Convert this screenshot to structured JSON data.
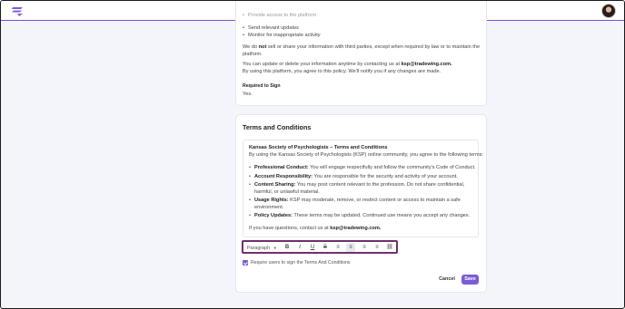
{
  "app": {
    "accent_color": "#7c5cd6",
    "toolbar_highlight_color": "#6f2f6e"
  },
  "privacy": {
    "bullet_partial": "Provide access to the platform",
    "bullets": [
      "Send relevant updates",
      "Monitor for inappropriate activity"
    ],
    "share_line1_pre": "We do ",
    "share_line1_bold": "not",
    "share_line1_post": " sell or share your information with third parties, except when required by law or to maintain the",
    "share_line2": "platform.",
    "update_line_pre": "You can update or delete your information anytime by contacting us at ",
    "update_line_email": "ksp@tradewing.com.",
    "agree_line": "By using this platform, you agree to this policy. We'll notify you if any changes are made.",
    "required_label": "Required to Sign",
    "required_value": "Yes."
  },
  "terms": {
    "section_title": "Terms and Conditions",
    "doc_title": "Kansas Society of Psychologists – Terms and Conditions",
    "intro": "By using the Kansas Society of Psychologists (KSP) online community, you agree to the following terms:",
    "items": [
      {
        "label": "Professional Conduct:",
        "text": " You will engage respectfully and follow the community's Code of Conduct."
      },
      {
        "label": "Account Responsibility:",
        "text": " You are responsible for the security and activity of your account."
      },
      {
        "label": "Content Sharing:",
        "text": " You may post content relevant to the profession. Do not share confidential,",
        "text2": "harmful, or unlawful material."
      },
      {
        "label": "Usage Rights:",
        "text": " KSP may moderate, remove, or restrict content or access to maintain a safe",
        "text2": "environment."
      },
      {
        "label": "Policy Updates:",
        "text": " These terms may be updated. Continued use means you accept any changes."
      }
    ],
    "contact_pre": "If you have questions, contact us at ",
    "contact_email": "ksp@tradewing.com."
  },
  "toolbar": {
    "paragraph_label": "Paragraph",
    "bold_glyph": "B",
    "italic_glyph": "I",
    "underline_glyph": "U",
    "strike_glyph": "S",
    "bullet_glyph": "≡",
    "align_left_glyph": "≡",
    "align_center_glyph": "≡",
    "align_right_glyph": "≡",
    "link_glyph": "⛓"
  },
  "signature": {
    "checkbox_label": "Require users to sign the Terms And Conditions",
    "checked": true
  },
  "actions": {
    "cancel_label": "Cancel",
    "save_label": "Save"
  }
}
